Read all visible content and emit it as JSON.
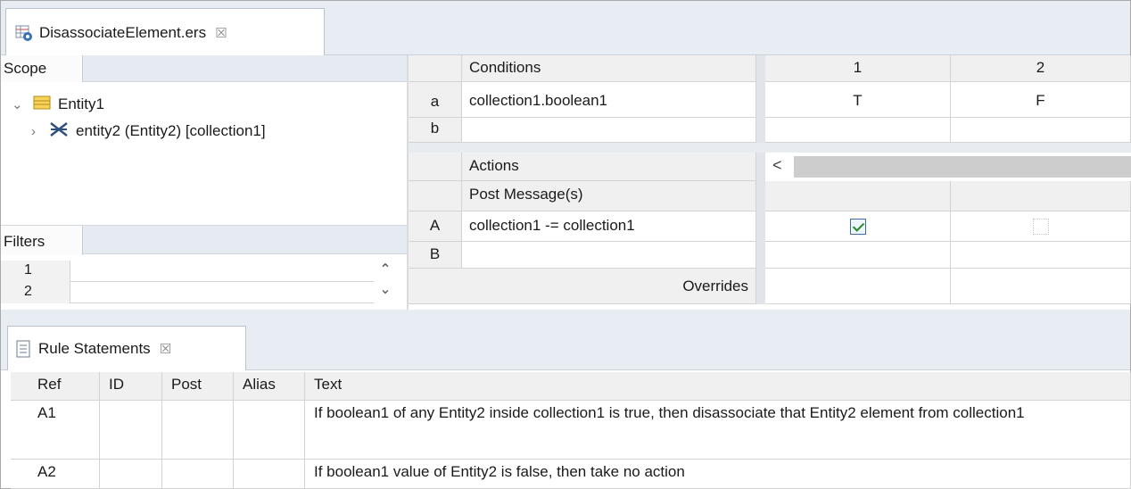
{
  "editor_tab": {
    "title": "DisassociateElement.ers",
    "close": "☒"
  },
  "scope": {
    "tab_label": "Scope",
    "tree": [
      {
        "label": "Entity1",
        "expanded": true
      },
      {
        "label": "entity2 (Entity2) [collection1]",
        "expanded": false
      }
    ]
  },
  "filters": {
    "tab_label": "Filters",
    "rows": [
      "1",
      "2"
    ]
  },
  "decision_table": {
    "conditions_header": "Conditions",
    "columns": [
      "1",
      "2"
    ],
    "conditions": [
      {
        "ref": "a",
        "text": "collection1.boolean1",
        "values": [
          "T",
          "F"
        ]
      },
      {
        "ref": "b",
        "text": "",
        "values": [
          "",
          ""
        ]
      }
    ],
    "actions_header": "Actions",
    "post_message_label": "Post Message(s)",
    "actions": [
      {
        "ref": "A",
        "text": "collection1 -= collection1",
        "checked": [
          true,
          false
        ]
      },
      {
        "ref": "B",
        "text": "",
        "checked": [
          null,
          null
        ]
      }
    ],
    "overrides_label": "Overrides",
    "scroll_left": "<"
  },
  "rule_statements": {
    "tab_label": "Rule Statements",
    "close": "☒",
    "headers": [
      "Ref",
      "ID",
      "Post",
      "Alias",
      "Text"
    ],
    "rows": [
      {
        "ref": "A1",
        "id": "",
        "post": "",
        "alias": "",
        "text": "If boolean1 of any Entity2 inside collection1 is true, then disassociate that Entity2 element from collection1"
      },
      {
        "ref": "A2",
        "id": "",
        "post": "",
        "alias": "",
        "text": "If boolean1 value of Entity2 is false, then take no action"
      }
    ]
  },
  "colors": {
    "chrome": "#e8edf4",
    "grid_line": "#d3d3d3",
    "header_bg": "#f0f0f0",
    "check": "#2a8a2a"
  },
  "icons": [
    "rule-editor-icon",
    "entity-icon",
    "association-icon",
    "chevron-down-icon",
    "chevron-right-icon",
    "document-icon",
    "close-icon",
    "scroll-up-icon",
    "scroll-down-icon",
    "scroll-left-icon"
  ]
}
